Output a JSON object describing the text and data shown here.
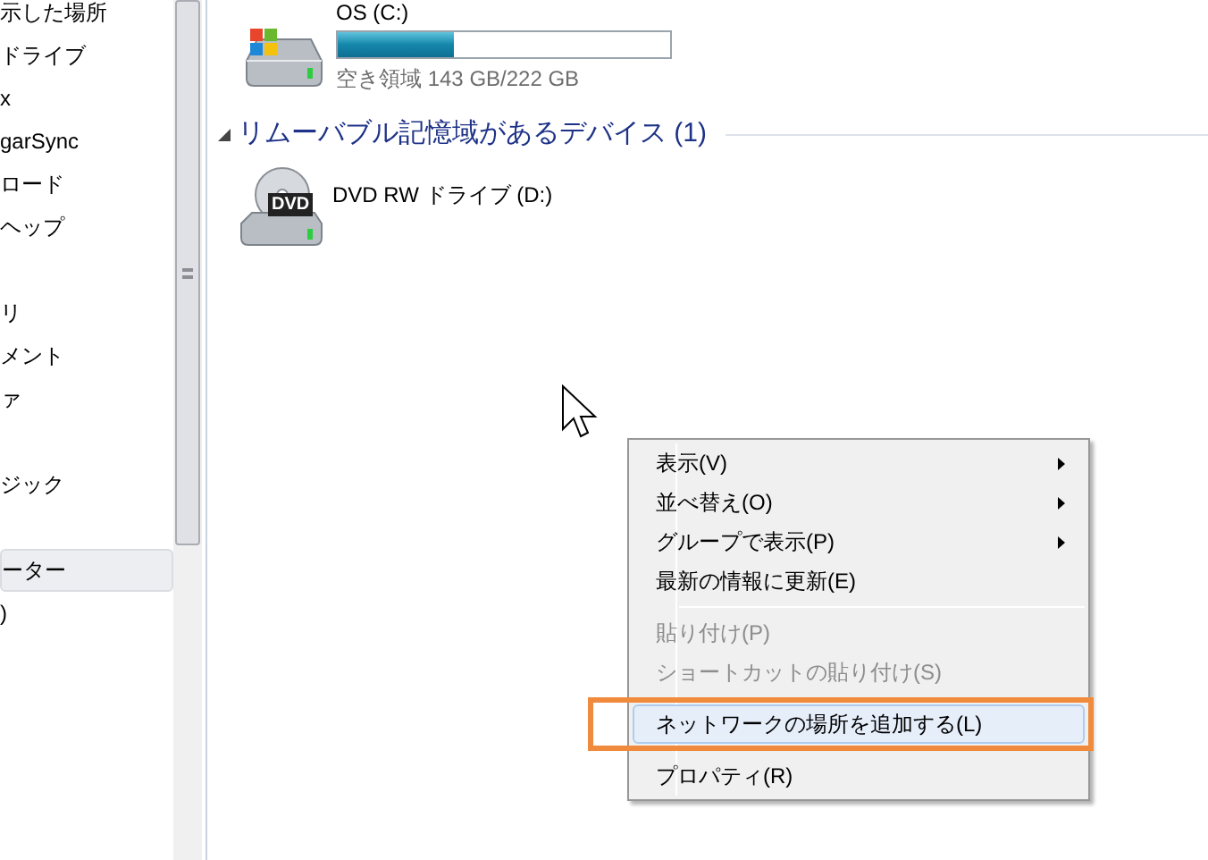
{
  "sidebar": {
    "groups": [
      {
        "items": [
          {
            "label": "示した場所",
            "selected": false
          },
          {
            "label": "ドライブ",
            "selected": false
          },
          {
            "label": "x",
            "selected": false
          },
          {
            "label": "garSync",
            "selected": false
          },
          {
            "label": "ロード",
            "selected": false
          },
          {
            "label": "ヘップ",
            "selected": false
          }
        ]
      },
      {
        "items": [
          {
            "label": "リ",
            "selected": false
          },
          {
            "label": "メント",
            "selected": false
          },
          {
            "label": "ァ",
            "selected": false
          }
        ]
      },
      {
        "items": [
          {
            "label": "ジック",
            "selected": false
          }
        ]
      },
      {
        "items": [
          {
            "label": "ーター",
            "selected": true
          },
          {
            "label": ")",
            "selected": false
          }
        ]
      }
    ]
  },
  "drives": [
    {
      "kind": "hdd",
      "name": "OS (C:)",
      "level": 0.35,
      "free": "空き領域 143 GB/222 GB"
    }
  ],
  "section": {
    "title": "リムーバブル記憶域があるデバイス (1)",
    "expanded": true
  },
  "removable": [
    {
      "kind": "dvd",
      "badge": "DVD",
      "name": "DVD RW ドライブ (D:)"
    }
  ],
  "context_menu": {
    "items": [
      {
        "kind": "item",
        "label": "表示(V)",
        "submenu": true,
        "disabled": false,
        "selected": false,
        "annotated": false
      },
      {
        "kind": "item",
        "label": "並べ替え(O)",
        "submenu": true,
        "disabled": false,
        "selected": false,
        "annotated": false
      },
      {
        "kind": "item",
        "label": "グループで表示(P)",
        "submenu": true,
        "disabled": false,
        "selected": false,
        "annotated": false
      },
      {
        "kind": "item",
        "label": "最新の情報に更新(E)",
        "submenu": false,
        "disabled": false,
        "selected": false,
        "annotated": false
      },
      {
        "kind": "separator"
      },
      {
        "kind": "item",
        "label": "貼り付け(P)",
        "submenu": false,
        "disabled": true,
        "selected": false,
        "annotated": false
      },
      {
        "kind": "item",
        "label": "ショートカットの貼り付け(S)",
        "submenu": false,
        "disabled": true,
        "selected": false,
        "annotated": false
      },
      {
        "kind": "separator"
      },
      {
        "kind": "item",
        "label": "ネットワークの場所を追加する(L)",
        "submenu": false,
        "disabled": false,
        "selected": true,
        "annotated": true
      },
      {
        "kind": "separator"
      },
      {
        "kind": "item",
        "label": "プロパティ(R)",
        "submenu": false,
        "disabled": false,
        "selected": false,
        "annotated": false
      }
    ]
  }
}
